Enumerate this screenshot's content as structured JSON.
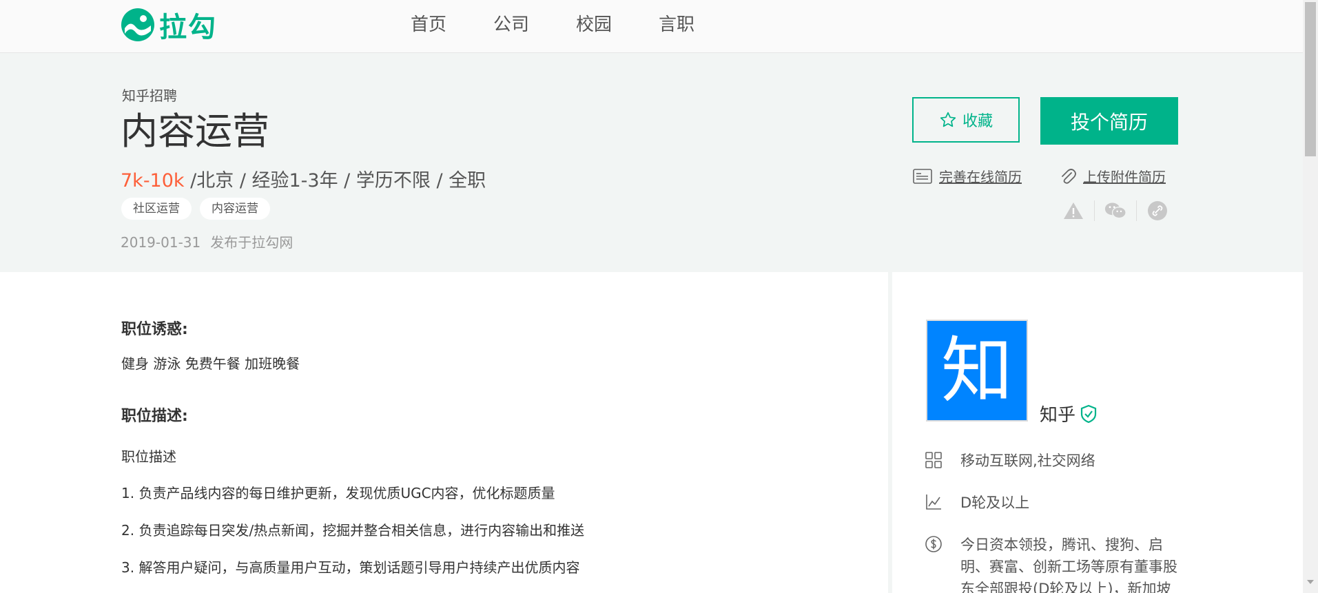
{
  "brand": {
    "logo_text": "拉勾",
    "accent": "#00b38a"
  },
  "nav": {
    "items": [
      "首页",
      "公司",
      "校园",
      "言职"
    ]
  },
  "job": {
    "company": "知乎招聘",
    "title": "内容运营",
    "salary": "7k-10k",
    "meta": " /北京 / 经验1-3年 / 学历不限 / 全职",
    "tags": [
      "社区运营",
      "内容运营"
    ],
    "publish_date": "2019-01-31",
    "publish_source": "发布于拉勾网",
    "salary_color": "#fd5f39"
  },
  "actions": {
    "collect_label": "收藏",
    "apply_label": "投个简历",
    "online_resume_label": "完善在线简历",
    "attach_resume_label": "上传附件简历"
  },
  "content": {
    "perks_title": "职位诱惑:",
    "perks": "健身 游泳 免费午餐 加班晚餐",
    "desc_title": "职位描述:",
    "desc_heading": "职位描述",
    "desc_items": [
      "1. 负责产品线内容的每日维护更新，发现优质UGC内容，优化标题质量",
      "2. 负责追踪每日突发/热点新闻，挖掘并整合相关信息，进行内容输出和推送",
      "3. 解答用户疑问，与高质量用户互动，策划话题引导用户持续产出优质内容"
    ]
  },
  "sidebar": {
    "logo_char": "知",
    "company_name": "知乎",
    "industry": "移动互联网,社交网络",
    "stage": "D轮及以上",
    "investors": "今日资本领投，腾讯、搜狗、启明、赛富、创新工场等原有董事股东全部跟投(D轮及以上)，新加坡"
  }
}
